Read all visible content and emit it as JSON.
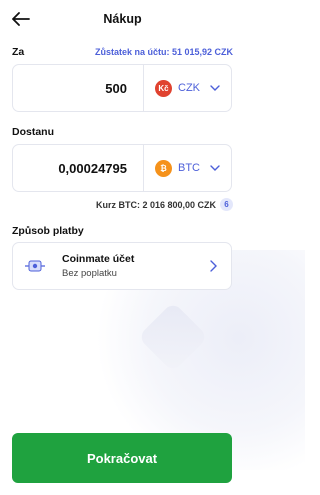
{
  "header": {
    "title": "Nákup"
  },
  "from": {
    "label": "Za",
    "balance": "Zůstatek na účtu: 51 015,92 CZK",
    "amount": "500",
    "currency": "CZK",
    "currency_icon": "Kč",
    "currency_color": "#e0422f"
  },
  "to": {
    "label": "Dostanu",
    "amount": "0,00024795",
    "currency": "BTC",
    "currency_icon": "₿",
    "currency_color": "#f5921b"
  },
  "rate": {
    "text": "Kurz BTC: 2 016 800,00 CZK",
    "info_glyph": "6"
  },
  "payment": {
    "label": "Způsob platby",
    "method_name": "Coinmate účet",
    "method_sub": "Bez poplatku",
    "icon": "coinmate-wallet-icon"
  },
  "cta": {
    "label": "Pokračovat",
    "color": "#1fa23f"
  },
  "accent": "#4c5fd9"
}
